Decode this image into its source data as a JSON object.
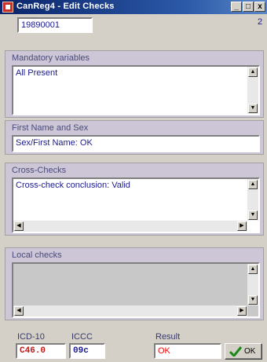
{
  "window": {
    "title": "CanReg4 - Edit Checks",
    "min": "_",
    "max": "□",
    "close": "x",
    "corner_char": "2"
  },
  "record_id": "19890001",
  "sections": {
    "mandatory": {
      "title": "Mandatory variables",
      "text": "All Present"
    },
    "first_name": {
      "title": "First Name and Sex",
      "text": "Sex/First Name: OK"
    },
    "cross_checks": {
      "title": "Cross-Checks",
      "text": "Cross-check conclusion: Valid"
    },
    "local": {
      "title": "Local checks",
      "text": ""
    }
  },
  "footer": {
    "icd_label": "ICD-10",
    "icd_value": "C46.0",
    "iccc_label": "ICCC",
    "iccc_value": "09c",
    "result_label": "Result",
    "result_value": "OK",
    "ok_label": "OK"
  },
  "colors": {
    "accent_value": "#c01818",
    "result_text": "#ff0000",
    "check_green": "#1a8a1a"
  },
  "icons": {
    "app": "canreg-app-icon",
    "ok": "checkmark-icon"
  }
}
